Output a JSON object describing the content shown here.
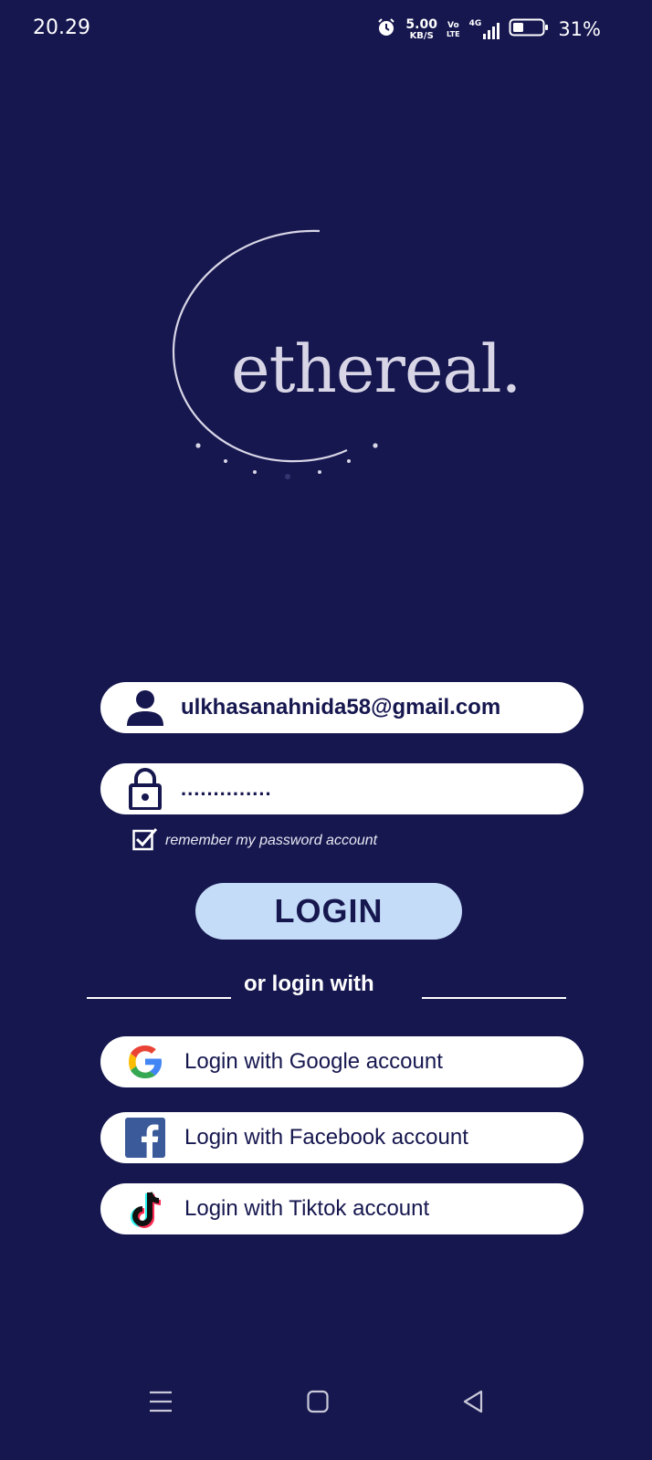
{
  "status_bar": {
    "time": "20.29",
    "speed_value": "5.00",
    "speed_unit": "KB/S",
    "volte_top": "Vo",
    "volte_bottom": "LTE",
    "network": "4G",
    "battery_percent": "31%",
    "battery_level": 0.31
  },
  "logo": {
    "text": "ethereal."
  },
  "login_form": {
    "email_value": "ulkhasanahnida58@gmail.com",
    "password_value": "..............",
    "remember_label": "remember my password account",
    "remember_checked": true,
    "login_label": "LOGIN"
  },
  "divider": {
    "label": "or login with"
  },
  "social": {
    "google_label": "Login with Google account",
    "facebook_label": "Login with Facebook account",
    "tiktok_label": "Login with Tiktok account"
  },
  "colors": {
    "background": "#16174f",
    "button": "#c4dcf8",
    "field": "#ffffff"
  }
}
